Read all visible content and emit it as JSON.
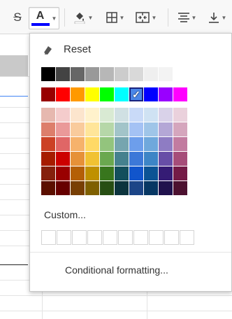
{
  "toolbar": {
    "items": [
      {
        "name": "strikethrough-icon",
        "glyph": "S̶"
      },
      {
        "name": "text-color-icon",
        "glyph": "A"
      },
      {
        "name": "fill-color-icon",
        "glyph": "▼"
      },
      {
        "name": "borders-icon",
        "glyph": "▦"
      },
      {
        "name": "merge-cells-icon",
        "glyph": "⊞"
      },
      {
        "name": "horizontal-align-icon",
        "glyph": "≡"
      },
      {
        "name": "vertical-align-icon",
        "glyph": "⊥"
      }
    ],
    "text_color_bar": "#0000ff"
  },
  "menu": {
    "reset_label": "Reset",
    "custom_label": "Custom...",
    "conditional_label": "Conditional formatting...",
    "selected_color": "#4a86e8",
    "grays": [
      "#000000",
      "#434343",
      "#666666",
      "#999999",
      "#b7b7b7",
      "#cccccc",
      "#d9d9d9",
      "#efefef",
      "#f3f3f3",
      "#ffffff"
    ],
    "brights": [
      "#980000",
      "#ff0000",
      "#ff9900",
      "#ffff00",
      "#00ff00",
      "#00ffff",
      "#4a86e8",
      "#0000ff",
      "#9900ff",
      "#ff00ff"
    ],
    "shades": [
      [
        "#e6b8af",
        "#f4cccc",
        "#fce5cd",
        "#fff2cc",
        "#d9ead3",
        "#d0e0e3",
        "#c9daf8",
        "#cfe2f3",
        "#d9d2e9",
        "#ead1dc"
      ],
      [
        "#dd7e6b",
        "#ea9999",
        "#f9cb9c",
        "#ffe599",
        "#b6d7a8",
        "#a2c4c9",
        "#a4c2f4",
        "#9fc5e8",
        "#b4a7d6",
        "#d5a6bd"
      ],
      [
        "#cc4125",
        "#e06666",
        "#f6b26b",
        "#ffd966",
        "#93c47d",
        "#76a5af",
        "#6d9eeb",
        "#6fa8dc",
        "#8e7cc3",
        "#c27ba0"
      ],
      [
        "#a61c00",
        "#cc0000",
        "#e69138",
        "#f1c232",
        "#6aa84f",
        "#45818e",
        "#3c78d8",
        "#3d85c6",
        "#674ea7",
        "#a64d79"
      ],
      [
        "#85200c",
        "#990000",
        "#b45f06",
        "#bf9000",
        "#38761d",
        "#134f5c",
        "#1155cc",
        "#0b5394",
        "#351c75",
        "#741b47"
      ],
      [
        "#5b0f00",
        "#660000",
        "#783f04",
        "#7f6000",
        "#274e13",
        "#0c343d",
        "#1c4587",
        "#073763",
        "#20124d",
        "#4c1130"
      ]
    ],
    "custom_slots": 10
  }
}
